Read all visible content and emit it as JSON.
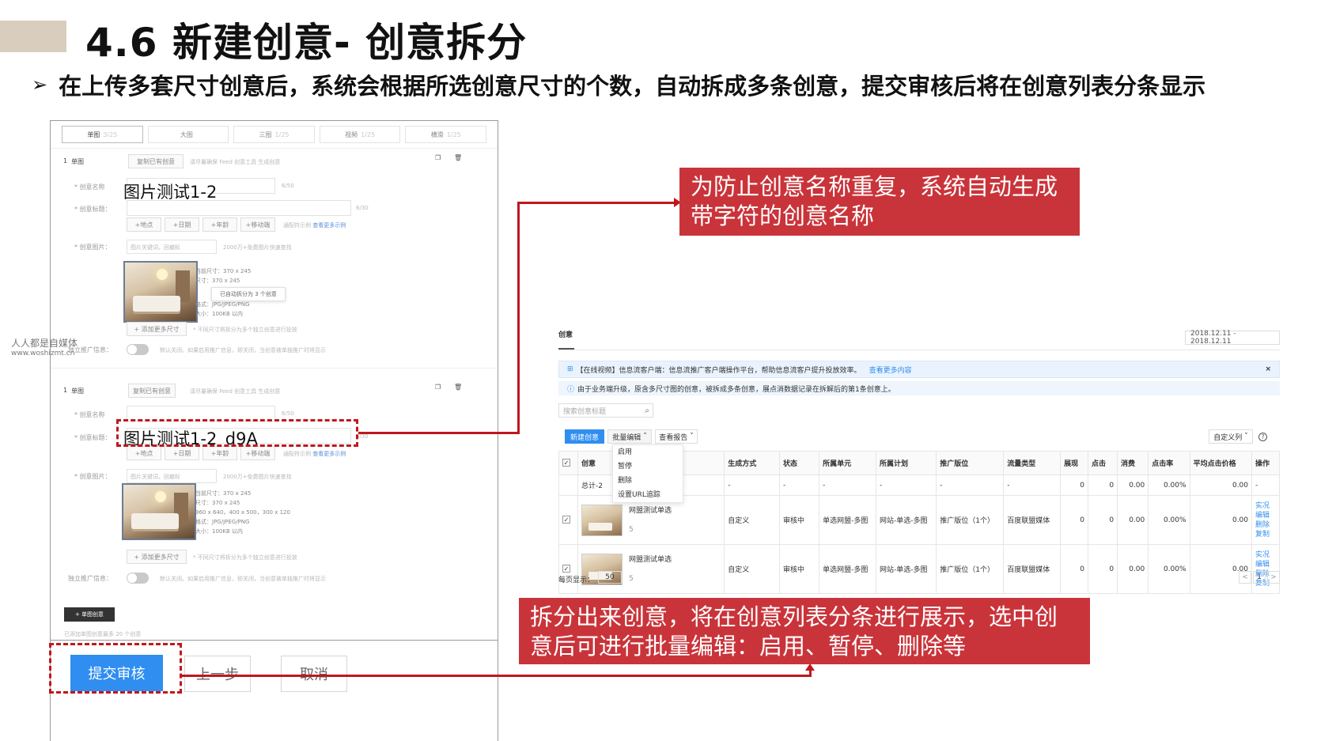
{
  "slide": {
    "title": "4.6 新建创意- 创意拆分",
    "bullet": "在上传多套尺寸创意后，系统会根据所选创意尺寸的个数，自动拆成多条创意，提交审核后将在创意列表分条显示"
  },
  "colors": {
    "accent_red": "#c9343a",
    "title_bar": "#d9cdbd",
    "primary_blue": "#2f8ef0",
    "status_orange": "#f0a03c"
  },
  "form": {
    "tabs": [
      {
        "label": "单图",
        "count": "3/25"
      },
      {
        "label": "大图",
        "count": ""
      },
      {
        "label": "三图",
        "count": "1/25"
      },
      {
        "label": "视频",
        "count": "1/25"
      },
      {
        "label": "横滑",
        "count": "1/25"
      }
    ],
    "units": [
      {
        "index": "1",
        "type": "单图",
        "copy_button": "复制已有创意",
        "tip": "请尽量确保 Feed 创意工具 生成创意",
        "name_label": "* 创意名称",
        "name_value": "图片测试1-2",
        "name_counter": "6/50",
        "title_label": "* 创意标题：",
        "title_counter": "6/30",
        "insert_buttons": [
          "+地点",
          "+日期",
          "+年龄",
          "+移动端"
        ],
        "title_tip": "通配符示例",
        "title_link": "查看更多示例",
        "image_label": "* 创意图片：",
        "image_search": "图片关键词，回撤标",
        "image_tip": "2000万+免费图片快速查找",
        "image_info": [
          "当前尺寸：370 x 245",
          "尺寸：370 x 245",
          "已自动拆分为 3 个创意",
          "格式：JPG/JPEG/PNG",
          "大小：100KB 以内"
        ],
        "add_size": "+ 添加更多尺寸",
        "add_size_tip": "* 不同尺寸将拆分为多个独立创意进行投放",
        "promo_label": "独立推广信息：",
        "promo_tip": "默认关闭。如果启用推广信息，即关闭，当创意被单独推广时将显示"
      },
      {
        "index": "1",
        "type": "单图",
        "copy_button": "复制已有创意",
        "tip": "请尽量确保 Feed 创意工具 生成创意",
        "name_label": "* 创意名称",
        "name_counter": "6/50",
        "title_label": "* 创意标题：",
        "title_value": "图片测试1-2_d9A",
        "title_counter": "6/30",
        "insert_buttons": [
          "+地点",
          "+日期",
          "+年龄",
          "+移动端"
        ],
        "title_tip": "通配符示例",
        "title_link": "查看更多示例",
        "image_label": "* 创意图片：",
        "image_search": "图片关键词，回撤标",
        "image_tip": "2000万+免费图片快速查找",
        "image_info": [
          "当前尺寸：370 x 245",
          "尺寸：370 x 245",
          "960 x 640，400 x 500，300 x 120",
          "格式：JPG/JPEG/PNG",
          "大小：100KB 以内"
        ],
        "add_size": "+ 添加更多尺寸",
        "add_size_tip": "* 不同尺寸将拆分为多个独立创意进行投放",
        "promo_label": "独立推广信息：",
        "promo_tip": "默认关闭。如果启用推广信息，即关闭，当创意被单独推广时将显示"
      }
    ],
    "add_unit_button": "+ 单图创意",
    "footer_tip": "已添加单图创意最多 20 个创意",
    "submit": "提交审核",
    "prev": "上一步",
    "cancel": "取消"
  },
  "callouts": {
    "top": "为防止创意名称重复，系统自动生成带字符的创意名称",
    "bottom": "拆分出来创意，将在创意列表分条进行展示，选中创意后可进行批量编辑：启用、暂停、删除等"
  },
  "list": {
    "tab": "创意",
    "date_range": "2018.12.11 - 2018.12.11",
    "notice": "【在线视频】信息流客户端：信息流推广客户端操作平台，帮助信息流客户提升投放效率。",
    "notice_link": "查看更多内容",
    "notice_close": "×",
    "info": "由于业务端升级，原含多尺寸图的创意，被拆成多条创意，展点消数据记录在拆解后的第1条创意上。",
    "search_placeholder": "搜索创意标题",
    "new_button": "新建创意",
    "batch_button": "批量编辑",
    "report_button": "查看报告",
    "custom_cols": "自定义列",
    "help": "?",
    "dropdown": [
      "启用",
      "暂停",
      "删除",
      "设置URL追踪"
    ],
    "columns": [
      "创意",
      "生成方式",
      "状态",
      "所属单元",
      "所属计划",
      "推广版位",
      "流量类型",
      "展现",
      "点击",
      "消费",
      "点击率",
      "平均点击价格",
      "操作"
    ],
    "total_row": [
      "总计-2",
      "-",
      "-",
      "-",
      "-",
      "-",
      "-",
      "0",
      "0",
      "0.00",
      "0.00%",
      "0.00",
      "-"
    ],
    "rows": [
      {
        "name": "网盟测试单选",
        "sub": "5",
        "method": "自定义",
        "status": "审核中",
        "unit": "单选网盟-多图",
        "plan": "网站-单选-多图",
        "slot": "推广版位（1个）",
        "traffic": "百度联盟媒体",
        "show": "0",
        "click": "0",
        "cost": "0.00",
        "ctr": "0.00%",
        "cpc": "0.00",
        "ops": [
          "实况",
          "编辑",
          "删除",
          "复制"
        ]
      },
      {
        "name": "网盟测试单选",
        "sub": "5",
        "method": "自定义",
        "status": "审核中",
        "unit": "单选网盟-多图",
        "plan": "网站-单选-多图",
        "slot": "推广版位（1个）",
        "traffic": "百度联盟媒体",
        "show": "0",
        "click": "0",
        "cost": "0.00",
        "ctr": "0.00%",
        "cpc": "0.00",
        "ops": [
          "实况",
          "编辑",
          "删除",
          "复制"
        ]
      }
    ],
    "per_page_label": "每页显示：",
    "per_page": "50",
    "page": "1",
    "prev_page": "<",
    "next_page": ">"
  },
  "watermark": {
    "line1": "人人都是自媒体",
    "line2": "www.woshizmt.cn"
  }
}
